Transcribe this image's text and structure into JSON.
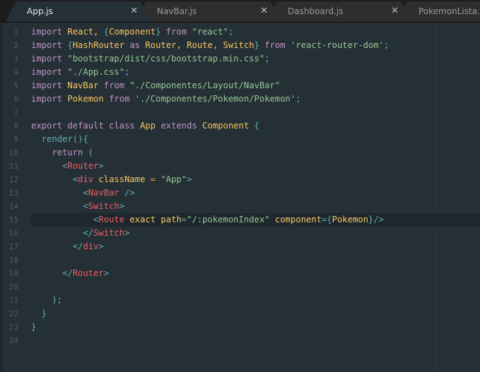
{
  "tabs": [
    {
      "label": "App.js",
      "active": true,
      "close": "✕"
    },
    {
      "label": "NavBar.js",
      "active": false,
      "close": "✕"
    },
    {
      "label": "Dashboard.js",
      "active": false,
      "close": "✕"
    },
    {
      "label": "PokemonLista.js",
      "active": false
    }
  ],
  "colors": {
    "keyword": "#c594c5",
    "identifier": "#fac863",
    "string": "#99c794",
    "punctuation": "#5fb3b3",
    "tag": "#ec5f67",
    "background": "#242f36"
  },
  "highlighted_line": 15,
  "lines": [
    [
      [
        "k",
        "import"
      ],
      [
        "",
        ""
      ],
      [
        "i",
        " React, "
      ],
      [
        "p",
        "{"
      ],
      [
        "i",
        "Component"
      ],
      [
        "p",
        "}"
      ],
      [
        "k",
        " from "
      ],
      [
        "s",
        "\"react\""
      ],
      [
        "p",
        ";"
      ]
    ],
    [
      [
        "k",
        "import "
      ],
      [
        "p",
        "{"
      ],
      [
        "i",
        "HashRouter "
      ],
      [
        "k",
        "as"
      ],
      [
        "i",
        " Router, Route, Switch"
      ],
      [
        "p",
        "}"
      ],
      [
        "k",
        " from "
      ],
      [
        "s",
        "'react-router-dom'"
      ],
      [
        "p",
        ";"
      ]
    ],
    [
      [
        "k",
        "import "
      ],
      [
        "s",
        "\"bootstrap/dist/css/bootstrap.min.css\""
      ],
      [
        "p",
        ";"
      ]
    ],
    [
      [
        "k",
        "import "
      ],
      [
        "s",
        "\"./App.css\""
      ],
      [
        "p",
        ";"
      ]
    ],
    [
      [
        "k",
        "import "
      ],
      [
        "i",
        "NavBar "
      ],
      [
        "k",
        "from "
      ],
      [
        "s",
        "\"./Componentes/Layout/NavBar\""
      ]
    ],
    [
      [
        "k",
        "import "
      ],
      [
        "i",
        "Pokemon "
      ],
      [
        "k",
        "from "
      ],
      [
        "s",
        "'./Componentes/Pokemon/Pokemon'"
      ],
      [
        "p",
        ";"
      ]
    ],
    [],
    [
      [
        "k",
        "export default class "
      ],
      [
        "i",
        "App "
      ],
      [
        "k",
        "extends "
      ],
      [
        "i",
        "Component "
      ],
      [
        "p",
        "{"
      ]
    ],
    [
      [
        "p",
        "  render(){"
      ]
    ],
    [
      [
        "k",
        "    return "
      ],
      [
        "p",
        "("
      ]
    ],
    [
      [
        "p",
        "      <"
      ],
      [
        "t",
        "Router"
      ],
      [
        "p",
        ">"
      ]
    ],
    [
      [
        "p",
        "        <"
      ],
      [
        "t",
        "div "
      ],
      [
        "i",
        "className "
      ],
      [
        "o",
        "= "
      ],
      [
        "s",
        "\"App\""
      ],
      [
        "p",
        ">"
      ]
    ],
    [
      [
        "p",
        "          <"
      ],
      [
        "t",
        "NavBar "
      ],
      [
        "p",
        "/>"
      ]
    ],
    [
      [
        "p",
        "          <"
      ],
      [
        "t",
        "Switch"
      ],
      [
        "p",
        ">"
      ]
    ],
    [
      [
        "p",
        "            <"
      ],
      [
        "t",
        "Route "
      ],
      [
        "i",
        "exact path"
      ],
      [
        "p",
        "="
      ],
      [
        "s",
        "\"/:pokemonIndex\""
      ],
      [
        "i",
        " component"
      ],
      [
        "p",
        "={"
      ],
      [
        "i",
        "Pokemon"
      ],
      [
        "p",
        "}/>"
      ]
    ],
    [
      [
        "p",
        "          </"
      ],
      [
        "t",
        "Switch"
      ],
      [
        "p",
        ">"
      ]
    ],
    [
      [
        "p",
        "        </"
      ],
      [
        "t",
        "div"
      ],
      [
        "p",
        ">"
      ]
    ],
    [],
    [
      [
        "p",
        "      </"
      ],
      [
        "t",
        "Router"
      ],
      [
        "p",
        ">"
      ]
    ],
    [],
    [
      [
        "p",
        "    );"
      ]
    ],
    [
      [
        "p",
        "  }"
      ]
    ],
    [
      [
        "p",
        "}"
      ]
    ],
    []
  ]
}
